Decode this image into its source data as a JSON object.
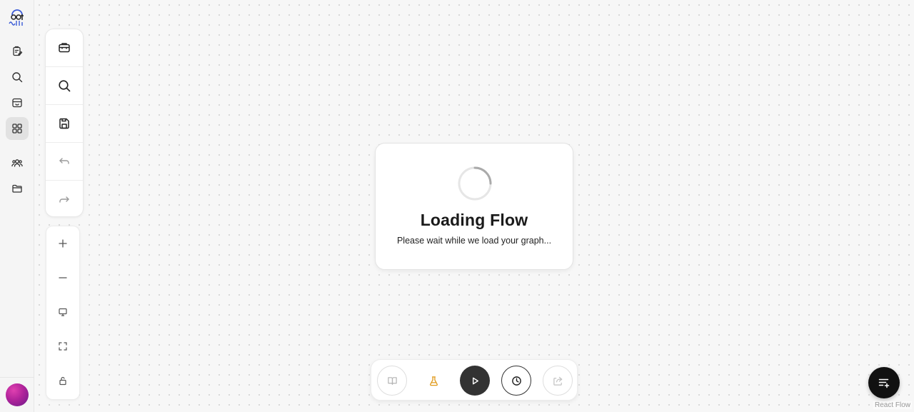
{
  "rail": {
    "items": [
      {
        "name": "flows",
        "icon": "clipboard-edit-icon",
        "active": false
      },
      {
        "name": "search",
        "icon": "search-icon",
        "active": false
      },
      {
        "name": "store",
        "icon": "store-icon",
        "active": false
      },
      {
        "name": "apps",
        "icon": "grid-icon",
        "active": true
      },
      {
        "name": "team",
        "icon": "users-icon",
        "active": false
      },
      {
        "name": "files",
        "icon": "folder-icon",
        "active": false
      }
    ]
  },
  "tools": [
    {
      "name": "components",
      "icon": "briefcase-icon"
    },
    {
      "name": "search",
      "icon": "search-icon"
    },
    {
      "name": "save",
      "icon": "save-icon"
    },
    {
      "name": "undo",
      "icon": "undo-icon"
    },
    {
      "name": "redo",
      "icon": "redo-icon"
    }
  ],
  "zoom": [
    {
      "name": "zoom-in",
      "icon": "plus-icon"
    },
    {
      "name": "zoom-out",
      "icon": "minus-icon"
    },
    {
      "name": "fit-view",
      "icon": "monitor-icon"
    },
    {
      "name": "fullscreen",
      "icon": "fullscreen-icon"
    },
    {
      "name": "lock",
      "icon": "unlock-icon"
    }
  ],
  "loading": {
    "title": "Loading Flow",
    "subtitle": "Please wait while we load your graph..."
  },
  "actionbar": [
    {
      "name": "docs",
      "icon": "book-icon"
    },
    {
      "name": "test",
      "icon": "flask-icon",
      "color": "#e09a1a"
    },
    {
      "name": "run",
      "icon": "play-icon"
    },
    {
      "name": "history",
      "icon": "clock-icon"
    },
    {
      "name": "share",
      "icon": "share-icon"
    }
  ],
  "attribution": "React Flow",
  "colors": {
    "accent_dark": "#333333",
    "flask": "#e09a1a",
    "avatar_primary": "#b0239a"
  }
}
